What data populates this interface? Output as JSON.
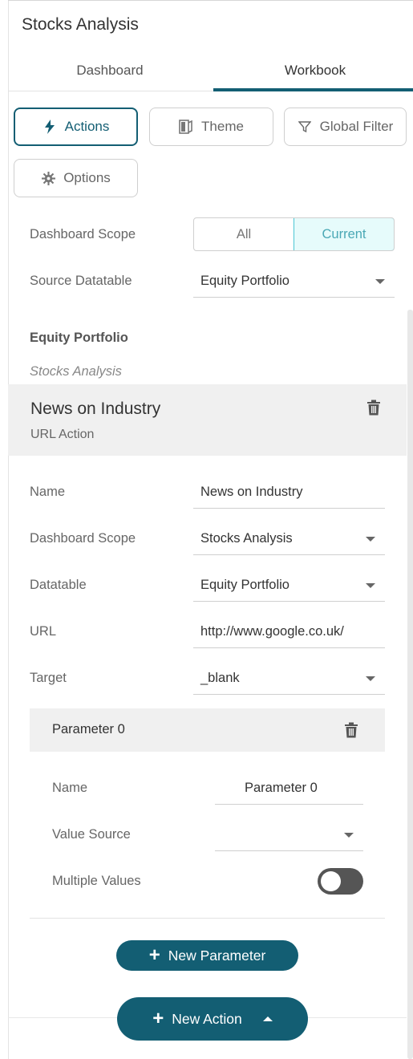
{
  "app": {
    "title": "Stocks Analysis"
  },
  "tabs": [
    {
      "label": "Dashboard",
      "active": false
    },
    {
      "label": "Workbook",
      "active": true
    }
  ],
  "toolbar": {
    "actions_label": "Actions",
    "theme_label": "Theme",
    "global_filter_label": "Global Filter",
    "options_label": "Options"
  },
  "scope": {
    "label": "Dashboard Scope",
    "options": [
      "All",
      "Current"
    ],
    "selected": "Current"
  },
  "source": {
    "label": "Source Datatable",
    "value": "Equity Portfolio"
  },
  "section": {
    "title": "Equity Portfolio",
    "subtitle": "Stocks Analysis"
  },
  "action": {
    "name": "News on Industry",
    "type": "URL Action",
    "fields": {
      "name_label": "Name",
      "name_value": "News on Industry",
      "scope_label": "Dashboard Scope",
      "scope_value": "Stocks Analysis",
      "datatable_label": "Datatable",
      "datatable_value": "Equity Portfolio",
      "url_label": "URL",
      "url_value": "http://www.google.co.uk/",
      "target_label": "Target",
      "target_value": "_blank"
    },
    "parameter": {
      "title": "Parameter 0",
      "name_label": "Name",
      "name_value": "Parameter 0",
      "value_source_label": "Value Source",
      "value_source_value": "",
      "multiple_values_label": "Multiple Values",
      "multiple_values_on": false
    }
  },
  "buttons": {
    "new_parameter": "New Parameter",
    "new_action": "New Action"
  },
  "colors": {
    "accent": "#135e73",
    "selected_segment": "#4cc7d4"
  }
}
